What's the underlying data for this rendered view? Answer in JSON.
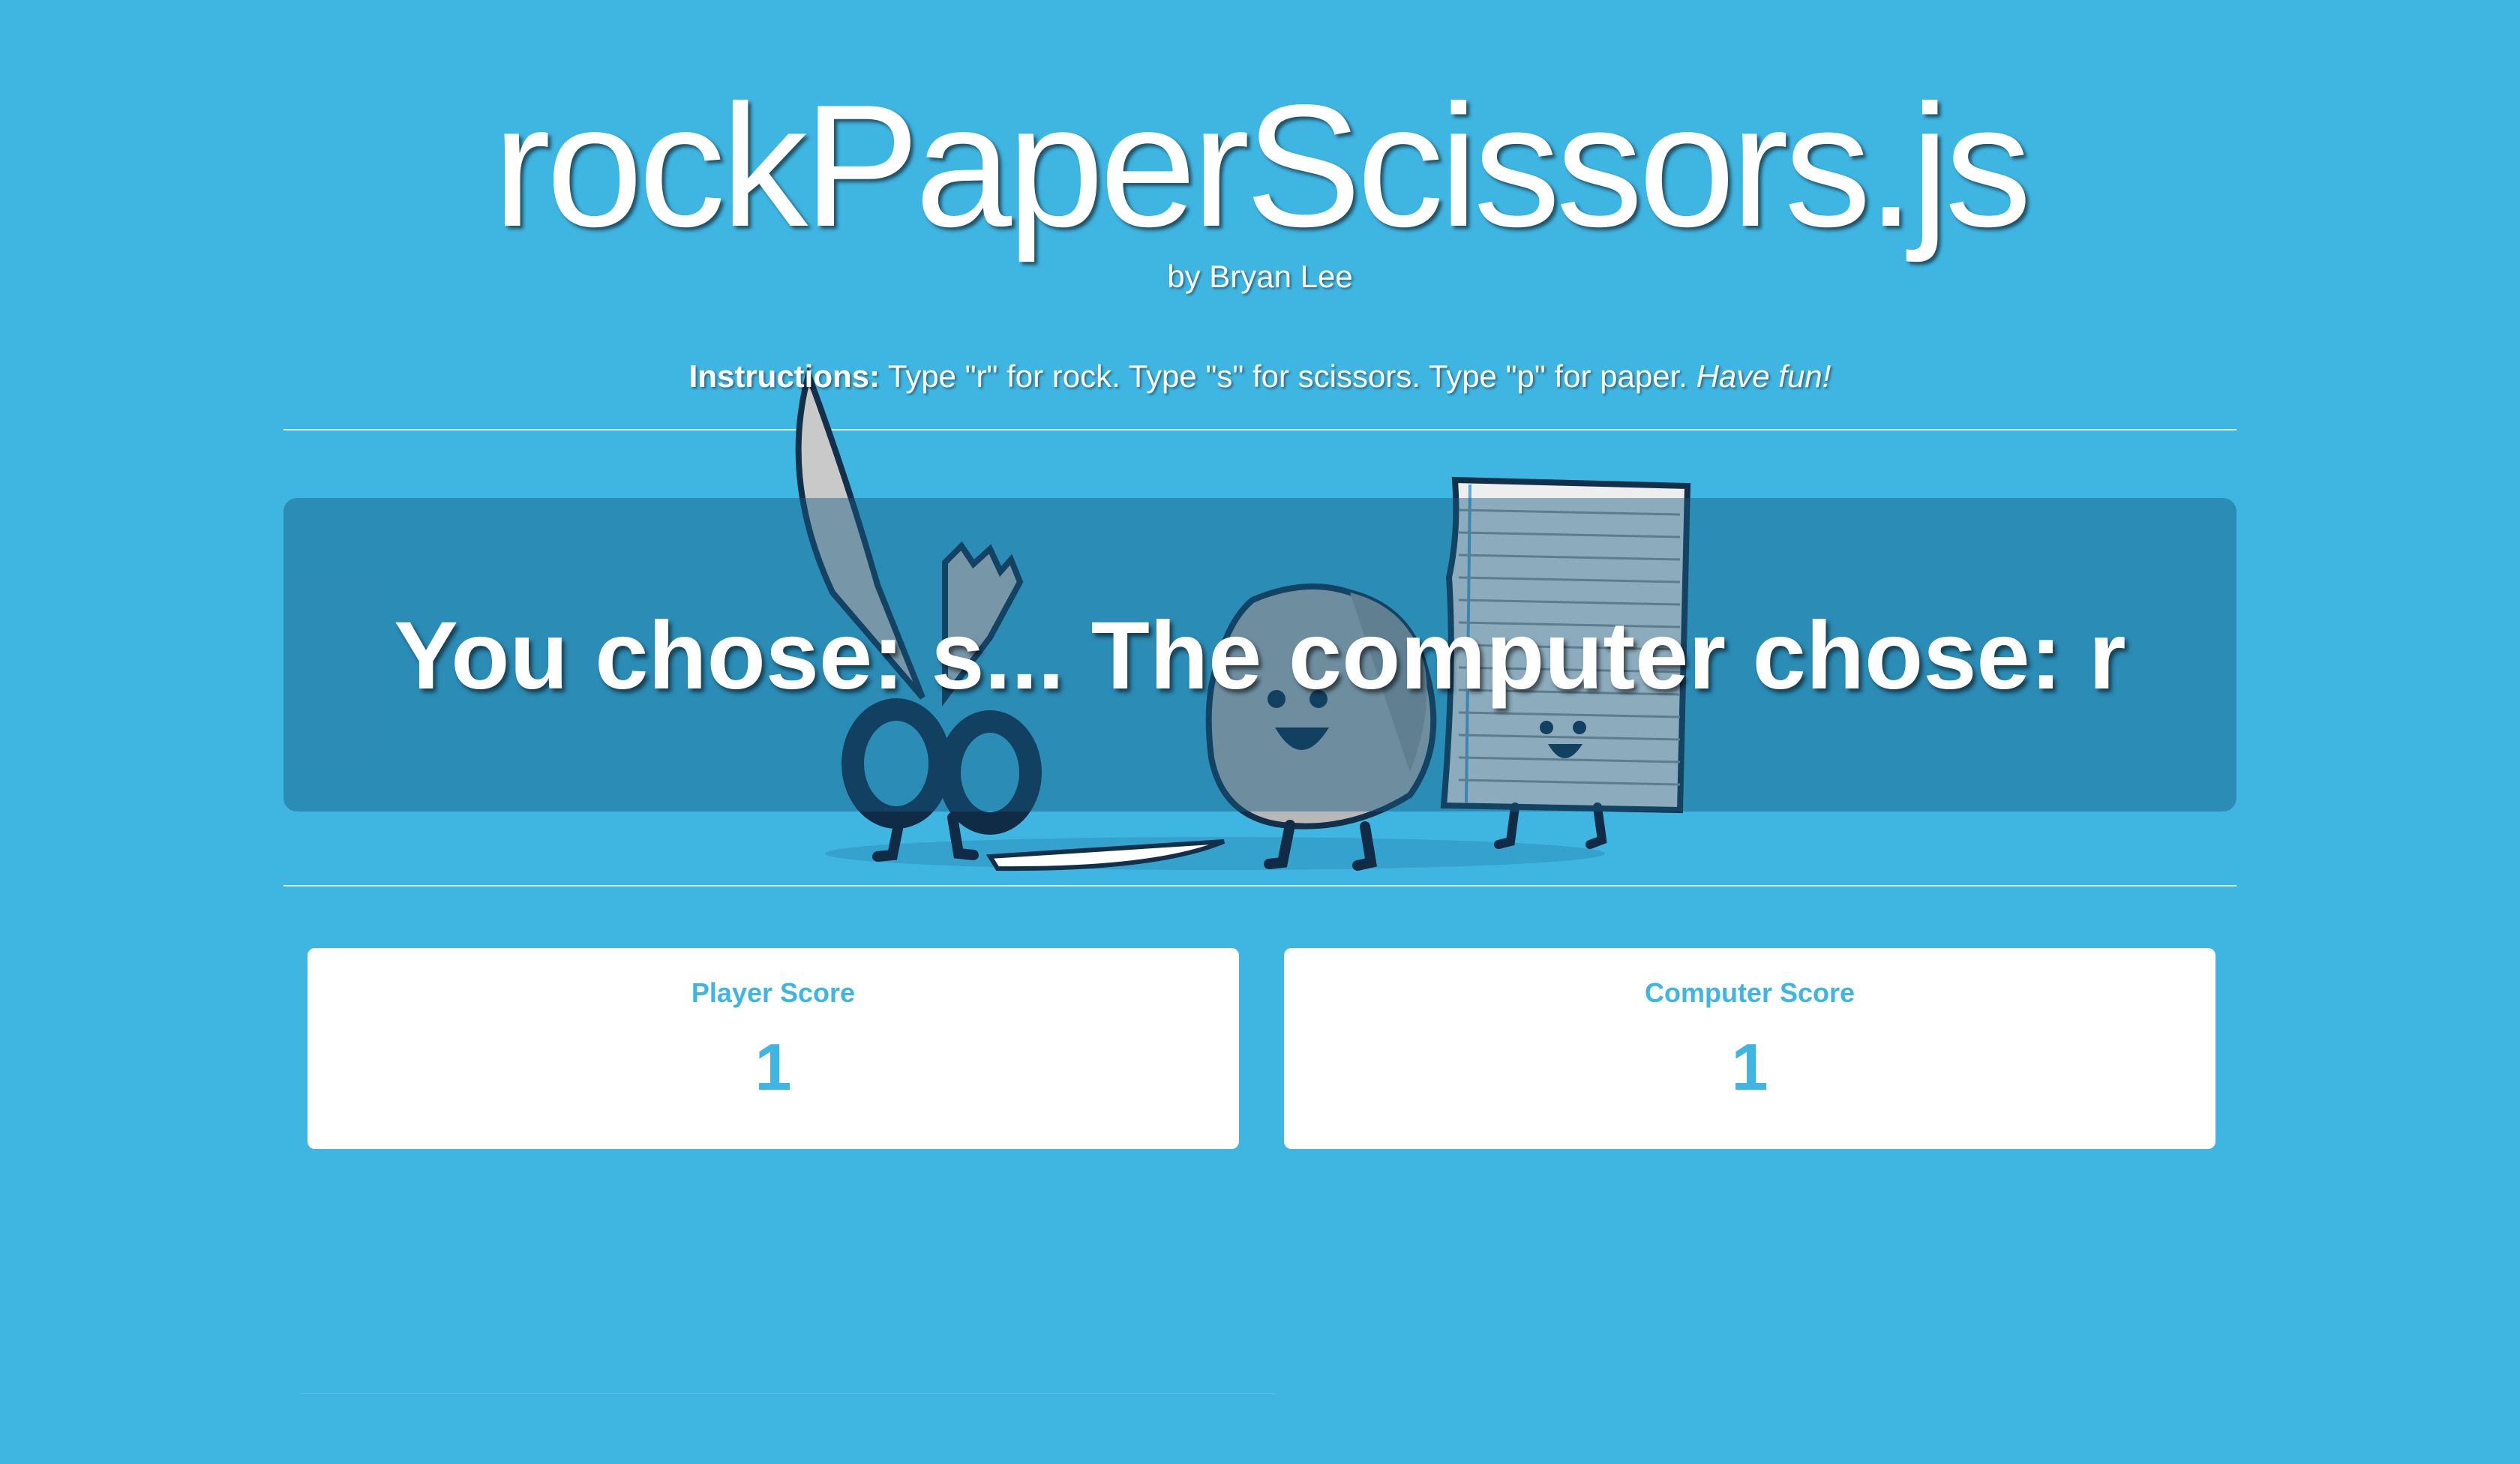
{
  "header": {
    "title": "rockPaperScissors.js",
    "byline": "by Bryan Lee"
  },
  "instructions": {
    "label": "Instructions:",
    "text": " Type \"r\" for rock. Type \"s\" for scissors. Type \"p\" for paper. ",
    "emphasis": "Have fun!"
  },
  "result": {
    "text": "You chose: s... The computer chose: r"
  },
  "scores": {
    "player": {
      "label": "Player Score",
      "value": "1"
    },
    "computer": {
      "label": "Computer Score",
      "value": "1"
    }
  },
  "icons": {
    "illustration": "rock-paper-scissors-characters-illustration"
  },
  "colors": {
    "background": "#3FB5E1",
    "card": "#FFFFFF",
    "accent": "#3FB5E1",
    "panel": "#2F8DB5"
  }
}
